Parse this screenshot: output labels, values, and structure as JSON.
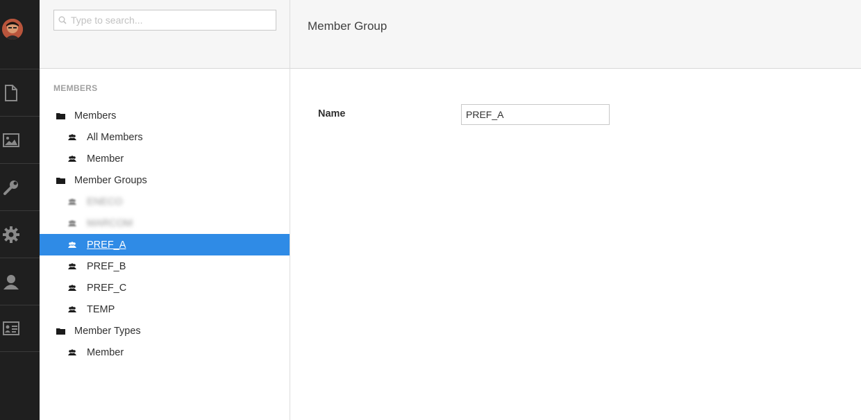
{
  "sections_rail": {
    "items": [
      {
        "icon": "document-icon"
      },
      {
        "icon": "image-icon"
      },
      {
        "icon": "wrench-icon"
      },
      {
        "icon": "gear-icon"
      },
      {
        "icon": "user-icon"
      },
      {
        "icon": "id-card-icon"
      }
    ]
  },
  "tree": {
    "search": {
      "placeholder": "Type to search..."
    },
    "section_title": "MEMBERS",
    "nodes": [
      {
        "label": "Members",
        "icon": "folder-icon"
      },
      {
        "label": "All Members",
        "icon": "members-icon"
      },
      {
        "label": "Member",
        "icon": "members-icon"
      },
      {
        "label": "Member Groups",
        "icon": "folder-icon"
      },
      {
        "label": "ENECO",
        "icon": "members-icon"
      },
      {
        "label": "MARCOM",
        "icon": "members-icon"
      },
      {
        "label": "PREF_A",
        "icon": "members-icon"
      },
      {
        "label": "PREF_B",
        "icon": "members-icon"
      },
      {
        "label": "PREF_C",
        "icon": "members-icon"
      },
      {
        "label": "TEMP",
        "icon": "members-icon"
      },
      {
        "label": "Member Types",
        "icon": "folder-icon"
      },
      {
        "label": "Member",
        "icon": "members-icon"
      }
    ]
  },
  "editor": {
    "title": "Member Group",
    "fields": [
      {
        "label": "Name",
        "value": "PREF_A"
      }
    ]
  },
  "colors": {
    "rail_bg": "#1f1f1f",
    "selected_bg": "#2f8be6",
    "header_bg": "#f6f6f6"
  }
}
